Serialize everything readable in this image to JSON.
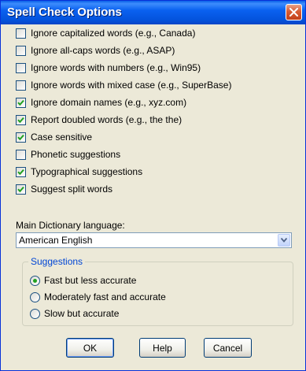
{
  "window": {
    "title": "Spell Check Options"
  },
  "options": [
    {
      "label": "Ignore capitalized words (e.g., Canada)",
      "checked": false
    },
    {
      "label": "Ignore all-caps words (e.g., ASAP)",
      "checked": false
    },
    {
      "label": "Ignore words with numbers (e.g., Win95)",
      "checked": false
    },
    {
      "label": "Ignore words with mixed case (e.g., SuperBase)",
      "checked": false
    },
    {
      "label": "Ignore domain names (e.g., xyz.com)",
      "checked": true
    },
    {
      "label": "Report doubled words (e.g., the the)",
      "checked": true
    },
    {
      "label": "Case sensitive",
      "checked": true
    },
    {
      "label": "Phonetic suggestions",
      "checked": false
    },
    {
      "label": "Typographical suggestions",
      "checked": true
    },
    {
      "label": "Suggest split words",
      "checked": true
    }
  ],
  "dictionary": {
    "label": "Main Dictionary language:",
    "value": "American English"
  },
  "suggestions": {
    "title": "Suggestions",
    "options": [
      {
        "label": "Fast but less accurate",
        "selected": true
      },
      {
        "label": "Moderately fast and accurate",
        "selected": false
      },
      {
        "label": "Slow but accurate",
        "selected": false
      }
    ]
  },
  "buttons": {
    "ok": "OK",
    "help": "Help",
    "cancel": "Cancel"
  },
  "colors": {
    "titlebar": "#0a5fe8",
    "face": "#ece9d8",
    "check": "#21a121",
    "group_title": "#0046d5"
  }
}
